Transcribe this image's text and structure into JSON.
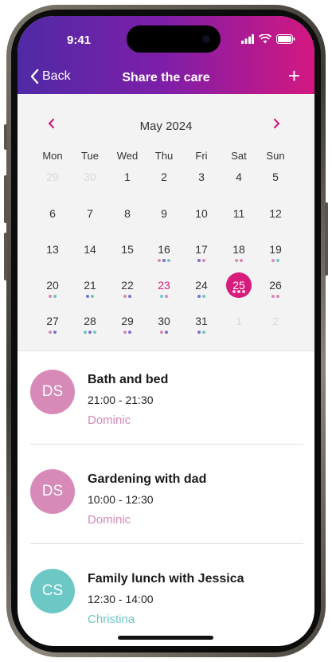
{
  "status": {
    "time": "9:41"
  },
  "nav": {
    "back_label": "Back",
    "title": "Share the care",
    "add_label": "+"
  },
  "calendar": {
    "month_label": "May 2024",
    "weekdays": [
      "Mon",
      "Tue",
      "Wed",
      "Thu",
      "Fri",
      "Sat",
      "Sun"
    ],
    "selected_day": "25",
    "rows": [
      [
        {
          "d": "29",
          "m": true
        },
        {
          "d": "30",
          "m": true
        },
        {
          "d": "1"
        },
        {
          "d": "2"
        },
        {
          "d": "3"
        },
        {
          "d": "4"
        },
        {
          "d": "5"
        }
      ],
      [
        {
          "d": "6"
        },
        {
          "d": "7"
        },
        {
          "d": "8"
        },
        {
          "d": "9"
        },
        {
          "d": "10"
        },
        {
          "d": "11"
        },
        {
          "d": "12"
        }
      ],
      [
        {
          "d": "13"
        },
        {
          "d": "14"
        },
        {
          "d": "15"
        },
        {
          "d": "16",
          "dots": [
            "#d789b8",
            "#7b6fd6",
            "#6cc8c4"
          ]
        },
        {
          "d": "17",
          "dots": [
            "#7b6fd6",
            "#d789b8"
          ]
        },
        {
          "d": "18",
          "dots": [
            "#d789b8",
            "#d789b8"
          ]
        },
        {
          "d": "19",
          "dots": [
            "#d789b8",
            "#6cc8c4"
          ]
        }
      ],
      [
        {
          "d": "20",
          "dots": [
            "#d789b8",
            "#6cc8c4"
          ]
        },
        {
          "d": "21",
          "dots": [
            "#7b6fd6",
            "#6cc8c4"
          ]
        },
        {
          "d": "22",
          "dots": [
            "#d789b8",
            "#7b6fd6"
          ]
        },
        {
          "d": "23",
          "pink": true,
          "dots": [
            "#6cc8c4",
            "#d789b8"
          ]
        },
        {
          "d": "24",
          "dots": [
            "#7b6fd6",
            "#6cc8c4"
          ]
        },
        {
          "d": "25",
          "dots": [
            "#d789b8",
            "#d789b8",
            "#6cc8c4"
          ]
        },
        {
          "d": "26",
          "dots": [
            "#d789b8",
            "#d789b8"
          ]
        }
      ],
      [
        {
          "d": "27",
          "dots": [
            "#d789b8",
            "#7b6fd6"
          ]
        },
        {
          "d": "28",
          "dots": [
            "#6cc8c4",
            "#7b6fd6",
            "#6cc8c4"
          ]
        },
        {
          "d": "29",
          "dots": [
            "#d789b8",
            "#7b6fd6"
          ]
        },
        {
          "d": "30",
          "dots": [
            "#d789b8",
            "#7b6fd6"
          ]
        },
        {
          "d": "31",
          "dots": [
            "#7b6fd6",
            "#6cc8c4"
          ]
        },
        {
          "d": "1",
          "m": true
        },
        {
          "d": "2",
          "m": true
        }
      ]
    ]
  },
  "events": [
    {
      "initials": "DS",
      "title": "Bath and bed",
      "time": "21:00 - 21:30",
      "person": "Dominic",
      "color": "#d789b8"
    },
    {
      "initials": "DS",
      "title": "Gardening with dad",
      "time": "10:00 - 12:30",
      "person": "Dominic",
      "color": "#d789b8"
    },
    {
      "initials": "CS",
      "title": "Family lunch with Jessica",
      "time": "12:30 - 14:00",
      "person": "Christina",
      "color": "#6cc8c4"
    }
  ],
  "colors": {
    "accent": "#d71c7c",
    "header_start": "#4f2aa6",
    "header_end": "#d41780"
  }
}
